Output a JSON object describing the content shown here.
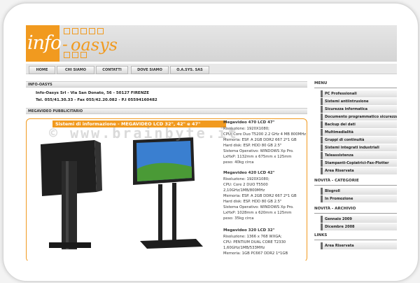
{
  "logo": {
    "info": "info",
    "dash": "-",
    "oasys": "oasys"
  },
  "nav": [
    "HOME",
    "CHI SIAMO",
    "CONTATTI",
    "DOVE SIAMO",
    "O.A.SYS. SAS"
  ],
  "left": {
    "section1": "INFO-OASYS",
    "company_line1": "Info-Oasys Srl - Via San Donato, 56 - 50127 FIRENZE",
    "company_line2": "Tel. 055/41.30.33 - Fax 055/42.20.082 - P.I 05594160482",
    "section2": "MEGAVIDEO PUBBLICITARIO",
    "banner_title": "Sistemi di informazione - MEGAVIDEO LCD 32\", 42\" e 47\"",
    "products": [
      {
        "title": "Megavideo 470 LCD 47\"",
        "specs": [
          "Risoluzione: 1920X1080;",
          "CPU: Core Duo T5200 2.2 GHz 4 MB 800MHz",
          "Memoria: ESP. A 2GB DDR2 667 2*1 GB",
          "Hard disk: ESP. HDD 80 GB 2.5\"",
          "Sistema Operativo: WINDOWS Xp Pro.",
          "LxHxP: 1132mm x 675mm x 125mm",
          "peso: 40kg circa"
        ]
      },
      {
        "title": "Megavideo 420 LCD 42\"",
        "specs": [
          "Risoluzione: 1920X1080;",
          "CPU: Core 2 DUO T5500",
          "2,10GHz/1MB/800MHz",
          "Memoria: ESP. A 2GB DDR2 667 2*1 GB",
          "Hard disk: ESP. HDD 80 GB 2.5\"",
          "Sistema Operativo: WINDOWS Xp Pro.",
          "LxHxP: 1028mm x 620mm x 125mm",
          "peso: 35kg circa"
        ]
      },
      {
        "title": "Megavideo 320 LCD 32\"",
        "specs": [
          "Risoluzione: 1366 x 768 WXGA;",
          "CPU: PENTIUM DUAL CORE T2330",
          "1,60GHz/1MB/533MHz",
          "Memoria: 1GB PC667 DDR2 1*1GB"
        ]
      }
    ]
  },
  "watermark": "© www.brainbyte.it",
  "right": {
    "menu_head": "MENU",
    "menu": [
      "PC Professionali",
      "Sistemi antiintrusione",
      "Sicurezza informatica",
      "Documento programmatico sicurezza",
      "Backup dei dati",
      "Multimedialità",
      "Gruppi di continuità",
      "Sistemi integrati industriali",
      "Teleassistenza",
      "Stampanti-Copiatrici-Fax-Plotter",
      "Area Riservata"
    ],
    "cat_head": "NOVITÀ - CATEGORIE",
    "cats": [
      "Blogroll",
      "In Promozione"
    ],
    "arch_head": "NOVITÀ - ARCHIVIO",
    "archive": [
      "Gennaio 2009",
      "Dicembre 2008"
    ],
    "links_head": "LINKS",
    "links": [
      "Area Riservata"
    ]
  }
}
